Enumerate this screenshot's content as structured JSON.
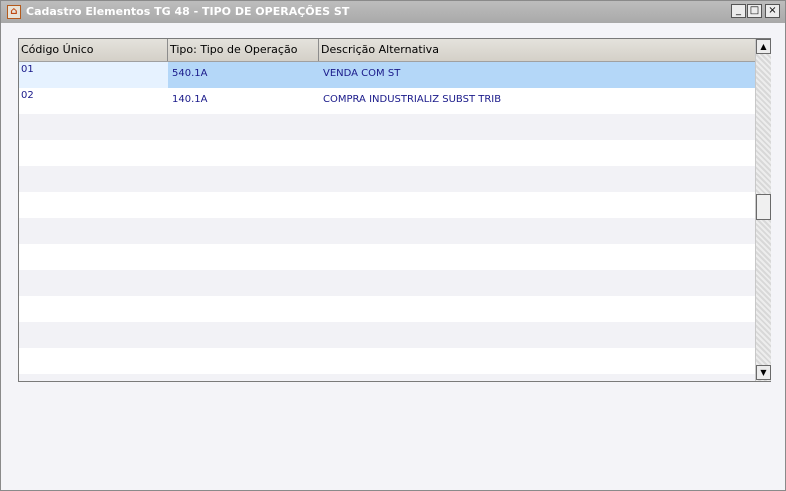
{
  "window": {
    "title": "Cadastro Elementos TG 48 - TIPO DE OPERAÇÕES ST",
    "icon": "app-house-icon",
    "controls": {
      "minimize": "_",
      "maximize": "□",
      "close": "×"
    }
  },
  "grid": {
    "columns": [
      "Código Único",
      "Tipo: Tipo de Operação",
      "Descrição Alternativa"
    ],
    "rows": [
      {
        "codigo": "01",
        "tipo": "540.1A",
        "descricao": "VENDA COM ST",
        "selected": true
      },
      {
        "codigo": "02",
        "tipo": "140.1A",
        "descricao": "COMPRA INDUSTRIALIZ SUBST TRIB",
        "selected": false
      }
    ],
    "scrollbar": {
      "up_arrow": "▲",
      "down_arrow": "▼"
    }
  },
  "colors": {
    "selected_row": "#b4d7f8",
    "cell_text": "#1a1a8a",
    "title_bar": "#a9a9a9"
  }
}
